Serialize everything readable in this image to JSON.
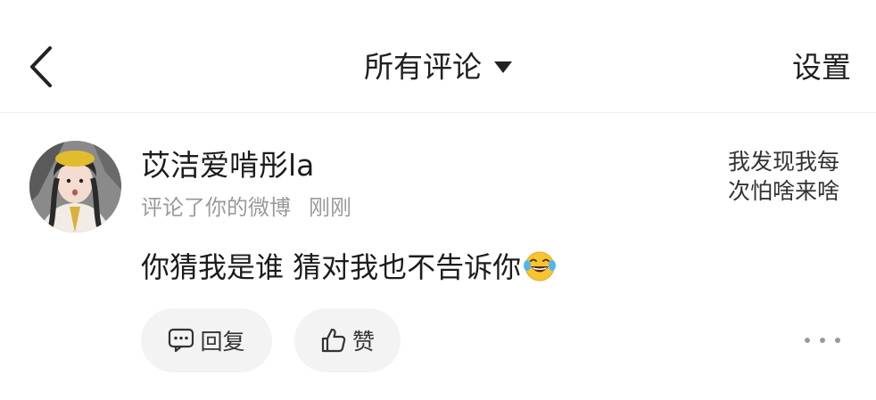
{
  "header": {
    "title": "所有评论",
    "settings_label": "设置"
  },
  "comment": {
    "username": "苡洁爱啃彤la",
    "action_text": "评论了你的微博",
    "time": "刚刚",
    "text": "你猜我是谁 猜对我也不告诉你",
    "emoji": "laugh-cry-emoji",
    "quoted_post": "我发现我每次怕啥来啥"
  },
  "actions": {
    "reply_label": "回复",
    "like_label": "赞"
  },
  "icons": {
    "back": "back-arrow-icon",
    "dropdown": "caret-down-icon",
    "reply": "comment-bubble-icon",
    "like": "thumbs-up-icon",
    "more": "more-dots-icon"
  },
  "colors": {
    "text_primary": "#1f1f1f",
    "text_secondary": "#9a9a9a",
    "button_bg": "#f3f3f3",
    "divider": "#eeeeee"
  }
}
